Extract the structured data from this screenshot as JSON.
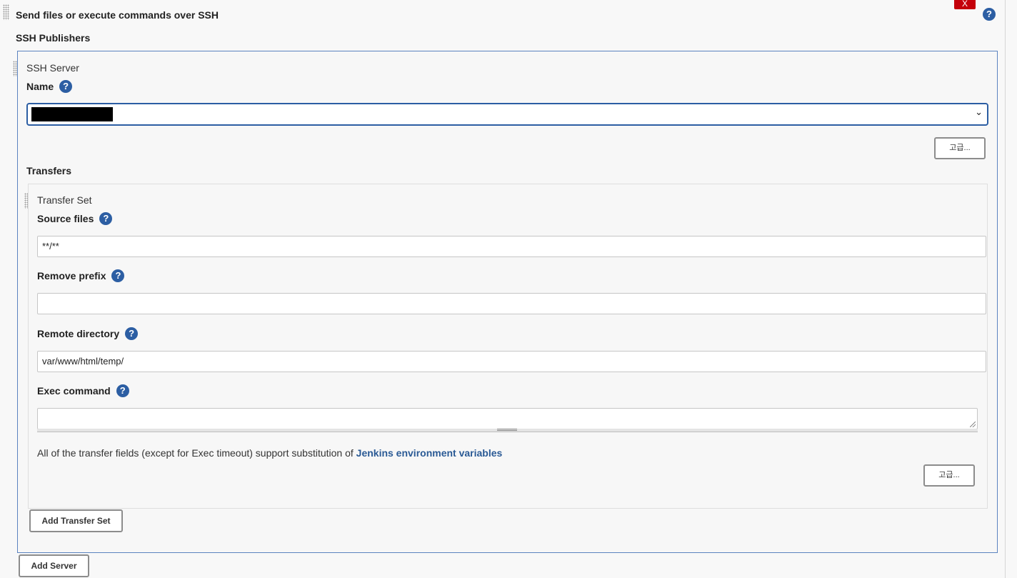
{
  "section": {
    "title": "Send files or execute commands over SSH",
    "delete_label": "X",
    "help_glyph": "?"
  },
  "publishers": {
    "label": "SSH Publishers",
    "server": {
      "heading": "SSH Server",
      "name_label": "Name",
      "name_value": "",
      "advanced_label": "고급..."
    },
    "transfers_label": "Transfers",
    "transfer_set": {
      "heading": "Transfer Set",
      "source_files_label": "Source files",
      "source_files_value": "**/**",
      "remove_prefix_label": "Remove prefix",
      "remove_prefix_value": "",
      "remote_directory_label": "Remote directory",
      "remote_directory_value": "var/www/html/temp/",
      "exec_command_label": "Exec command",
      "exec_command_value": "",
      "note_text": "All of the transfer fields (except for Exec timeout) support substitution of ",
      "note_link": "Jenkins environment variables",
      "advanced_label": "고급..."
    },
    "add_transfer_set_label": "Add Transfer Set",
    "add_server_label": "Add Server"
  },
  "icons": {
    "help": "question-circle-icon",
    "drag": "drag-handle-icon",
    "select": "chevron-down-icon"
  },
  "colors": {
    "help_blue": "#2c5ea3",
    "delete_red": "#c4000a",
    "link_blue": "#2a5a95",
    "focus_border": "#2c5ea3"
  }
}
